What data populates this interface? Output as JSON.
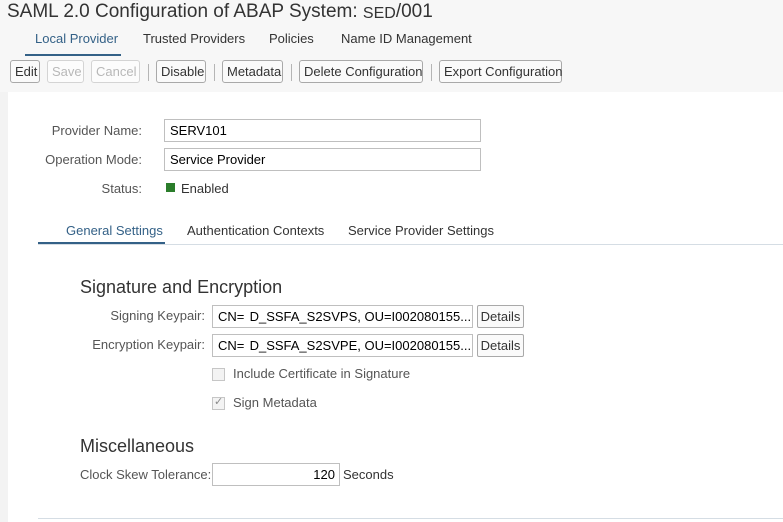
{
  "header": {
    "title": "SAML 2.0 Configuration of ABAP System:",
    "system_id": "SED",
    "client": "/001"
  },
  "main_tabs": [
    {
      "label": "Local Provider",
      "active": true
    },
    {
      "label": "Trusted Providers",
      "active": false
    },
    {
      "label": "Policies",
      "active": false
    },
    {
      "label": "Name ID Management",
      "active": false
    }
  ],
  "toolbar": {
    "edit": "Edit",
    "save": "Save",
    "cancel": "Cancel",
    "disable": "Disable",
    "metadata": "Metadata",
    "delete_configuration": "Delete Configuration",
    "export_configuration": "Export Configuration"
  },
  "provider": {
    "name_label": "Provider Name:",
    "name_value": "SERV101",
    "mode_label": "Operation Mode:",
    "mode_value": "Service Provider",
    "status_label": "Status:",
    "status_value": "Enabled",
    "status_color": "#2b7d2b"
  },
  "sub_tabs": [
    {
      "label": "General Settings",
      "active": true
    },
    {
      "label": "Authentication Contexts",
      "active": false
    },
    {
      "label": "Service Provider Settings",
      "active": false
    }
  ],
  "signature": {
    "title": "Signature and Encryption",
    "signing_label": "Signing Keypair:",
    "signing_value": "CN=  D_SSFA_S2SVPS, OU=I002080155...",
    "encryption_label": "Encryption Keypair:",
    "encryption_value": "CN=  D_SSFA_S2SVPE, OU=I002080155...",
    "details": "Details",
    "include_cert_label": "Include Certificate in Signature",
    "include_cert_checked": false,
    "sign_metadata_label": "Sign Metadata",
    "sign_metadata_checked": true
  },
  "misc": {
    "title": "Miscellaneous",
    "clock_skew_label": "Clock Skew Tolerance:",
    "clock_skew_value": "120",
    "clock_skew_unit": "Seconds"
  },
  "colors": {
    "accent": "#346187",
    "header_bg": "#f7f7f7"
  }
}
